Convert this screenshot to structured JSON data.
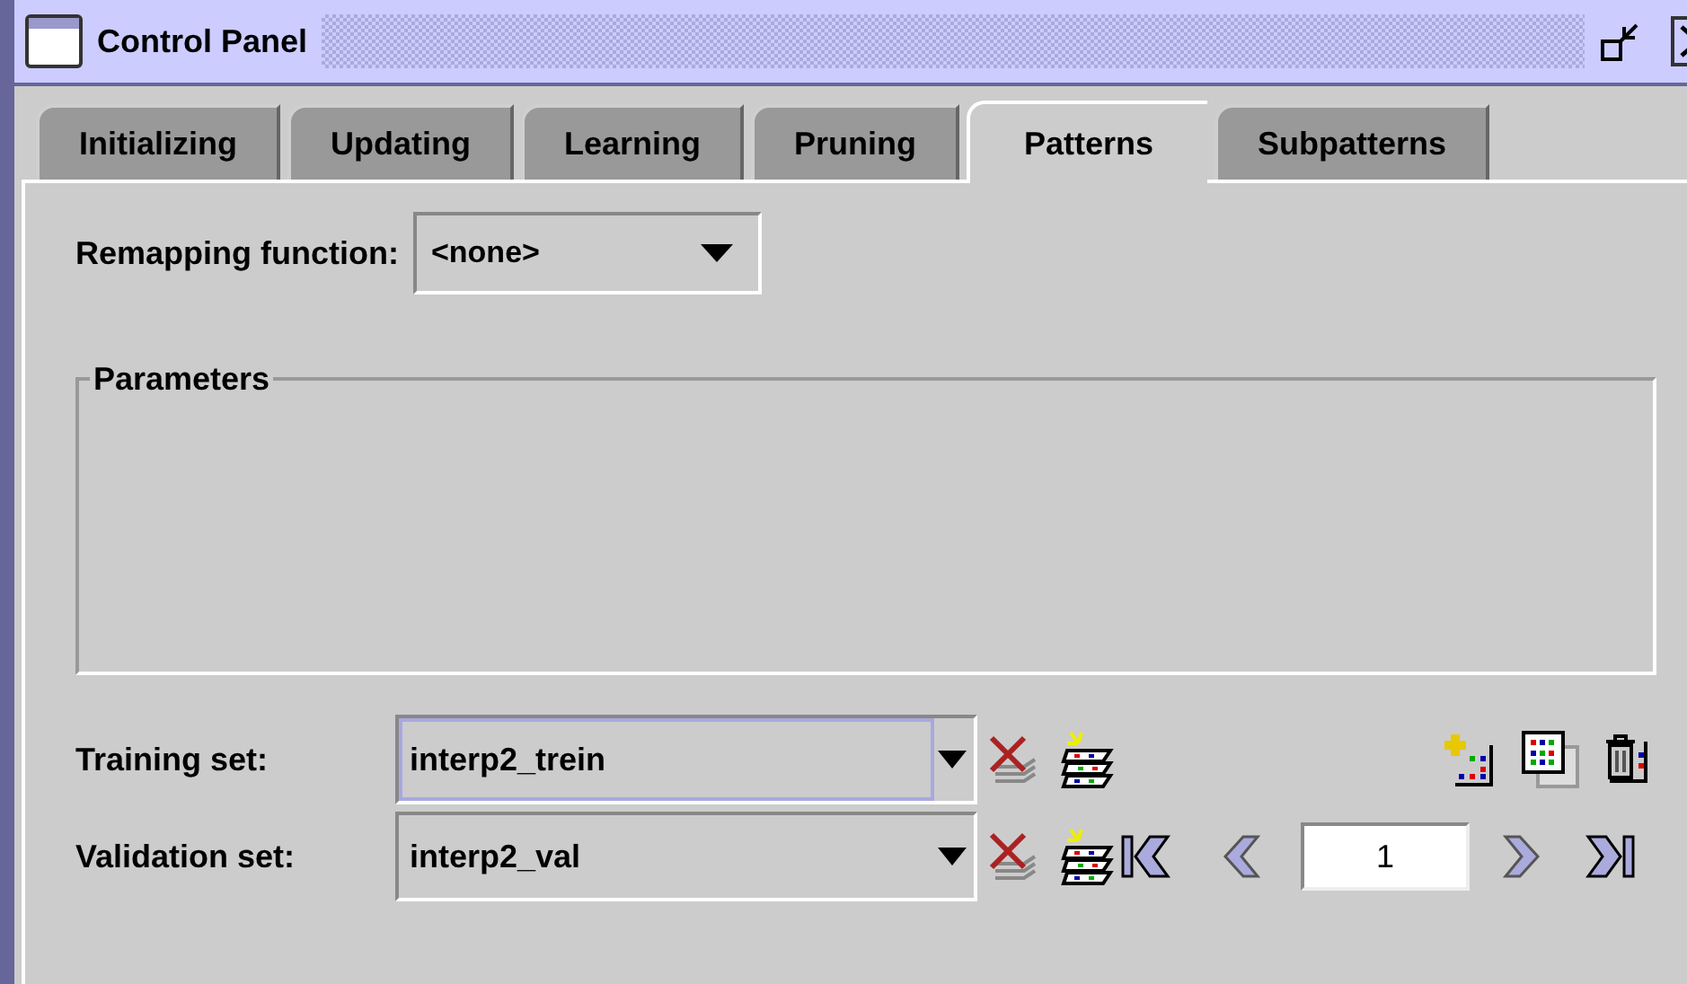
{
  "window": {
    "title": "Control Panel"
  },
  "tabs": [
    {
      "label": "Initializing",
      "selected": false
    },
    {
      "label": "Updating",
      "selected": false
    },
    {
      "label": "Learning",
      "selected": false
    },
    {
      "label": "Pruning",
      "selected": false
    },
    {
      "label": "Patterns",
      "selected": true
    },
    {
      "label": "Subpatterns",
      "selected": false
    }
  ],
  "remapping": {
    "label": "Remapping function:",
    "value": "<none>"
  },
  "parameters": {
    "title": "Parameters"
  },
  "training_set": {
    "label": "Training set:",
    "value": "interp2_trein",
    "focused": true
  },
  "validation_set": {
    "label": "Validation set:",
    "value": "interp2_val",
    "focused": false
  },
  "page": {
    "value": "1"
  }
}
